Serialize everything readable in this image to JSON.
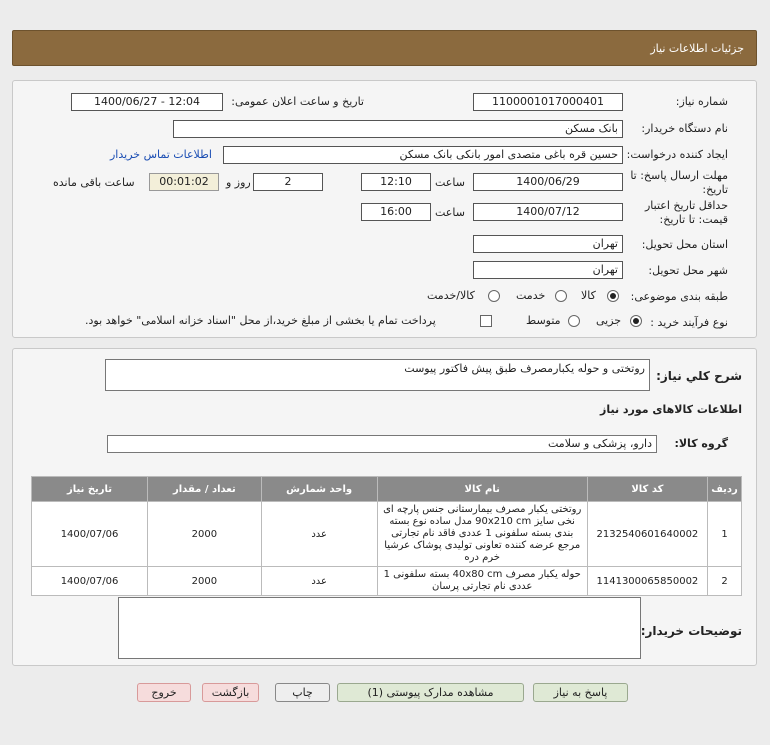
{
  "header_title": "جزئیات اطلاعات نیاز",
  "form": {
    "need_number_label": "شماره نیاز:",
    "need_number": "1100001017000401",
    "announce_label": "تاریخ و ساعت اعلان عمومی:",
    "announce_value": "1400/06/27 - 12:04",
    "buyer_org_label": "نام دستگاه خریدار:",
    "buyer_org": "بانک مسکن",
    "creator_label": "ایجاد کننده درخواست:",
    "creator": "حسین  قره باغی متصدی امور بانکی بانک مسکن",
    "contact_link": "اطلاعات تماس خریدار",
    "deadline_label_1": "مهلت ارسال پاسخ: تا",
    "deadline_label_2": "تاریخ:",
    "deadline_date": "1400/06/29",
    "time_label": "ساعت",
    "deadline_time": "12:10",
    "days_value": "2",
    "days_label": "روز و",
    "remaining_value": "00:01:02",
    "remaining_label": "ساعت باقی مانده",
    "validity_label_1": "حداقل تاریخ اعتبار",
    "validity_label_2": "قیمت: تا تاریخ:",
    "validity_date": "1400/07/12",
    "validity_time": "16:00",
    "province_label": "استان محل تحویل:",
    "province": "تهران",
    "city_label": "شهر محل تحویل:",
    "city": "تهران",
    "category_label": "طبقه بندی موضوعی:",
    "category_options": [
      "کالا",
      "خدمت",
      "کالا/خدمت"
    ],
    "process_label": "نوع فرآیند خرید :",
    "process_options": [
      "جزیی",
      "متوسط"
    ],
    "payment_note": "پرداخت تمام یا بخشی از مبلغ خرید،از محل \"اسناد خزانه اسلامی\" خواهد بود."
  },
  "details": {
    "summary_label": "شرح كلي نياز:",
    "summary": "روتختی و حوله یکبارمصرف طبق پیش فاکتور پیوست",
    "goods_info_title": "اطلاعات کالاهای مورد نیاز",
    "goods_group_label": "گروه کالا:",
    "goods_group": "دارو، پزشکی و سلامت",
    "table_headers": [
      "ردیف",
      "کد کالا",
      "نام کالا",
      "واحد شمارش",
      "تعداد / مقدار",
      "تاریخ نیاز"
    ],
    "rows": [
      {
        "idx": "1",
        "code": "2132540601640002",
        "name": "روتختی یکبار مصرف بیمارستانی جنس پارچه ای نخی سایز 90x210 cm مدل ساده نوع بسته بندی بسته سلفونی 1 عددی فاقد نام تجارتی مرجع عرضه کننده تعاونی تولیدی پوشاک عرشیا خرم دره",
        "unit": "عدد",
        "qty": "2000",
        "date": "1400/07/06"
      },
      {
        "idx": "2",
        "code": "1141300065850002",
        "name": "حوله یکبار مصرف 40x80 cm بسته سلفونی 1 عددی نام تجارتی پرسان",
        "unit": "عدد",
        "qty": "2000",
        "date": "1400/07/06"
      }
    ],
    "buyer_notes_label": "توضیحات خریدار:",
    "buyer_notes": ""
  },
  "buttons": {
    "reply": "پاسخ به نیاز",
    "attachments": "مشاهده مدارک پیوستی (1)",
    "print": "چاپ",
    "back": "بازگشت",
    "exit": "خروج"
  }
}
